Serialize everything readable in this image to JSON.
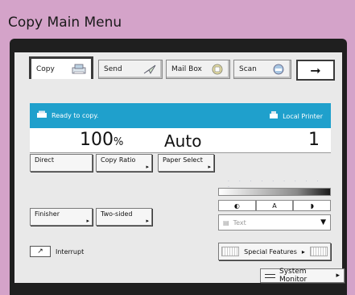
{
  "page_title": "Copy Main Menu",
  "tabs": [
    {
      "label": "Copy",
      "icon": "copier-icon",
      "active": true
    },
    {
      "label": "Send",
      "icon": "send-icon",
      "active": false
    },
    {
      "label": "Mail Box",
      "icon": "mailbox-icon",
      "active": false
    },
    {
      "label": "Scan",
      "icon": "scanner-icon",
      "active": false
    }
  ],
  "tab_more_icon": "arrow-right-icon",
  "status": {
    "message": "Ready to copy.",
    "printer": "Local Printer",
    "color": "#1fa0cc"
  },
  "values": {
    "ratio": "100",
    "ratio_unit": "%",
    "paper": "Auto",
    "copies": "1"
  },
  "buttons": {
    "direct": "Direct",
    "copy_ratio": "Copy Ratio",
    "paper_select": "Paper Select",
    "finisher": "Finisher",
    "two_sided": "Two-sided",
    "interrupt": "Interrupt",
    "special_features": "Special Features",
    "system_monitor": "System Monitor"
  },
  "density": {
    "lighter_icon": "light-density-icon",
    "auto_label": "A",
    "darker_icon": "dark-density-icon"
  },
  "image_mode": {
    "selected": "Text"
  }
}
